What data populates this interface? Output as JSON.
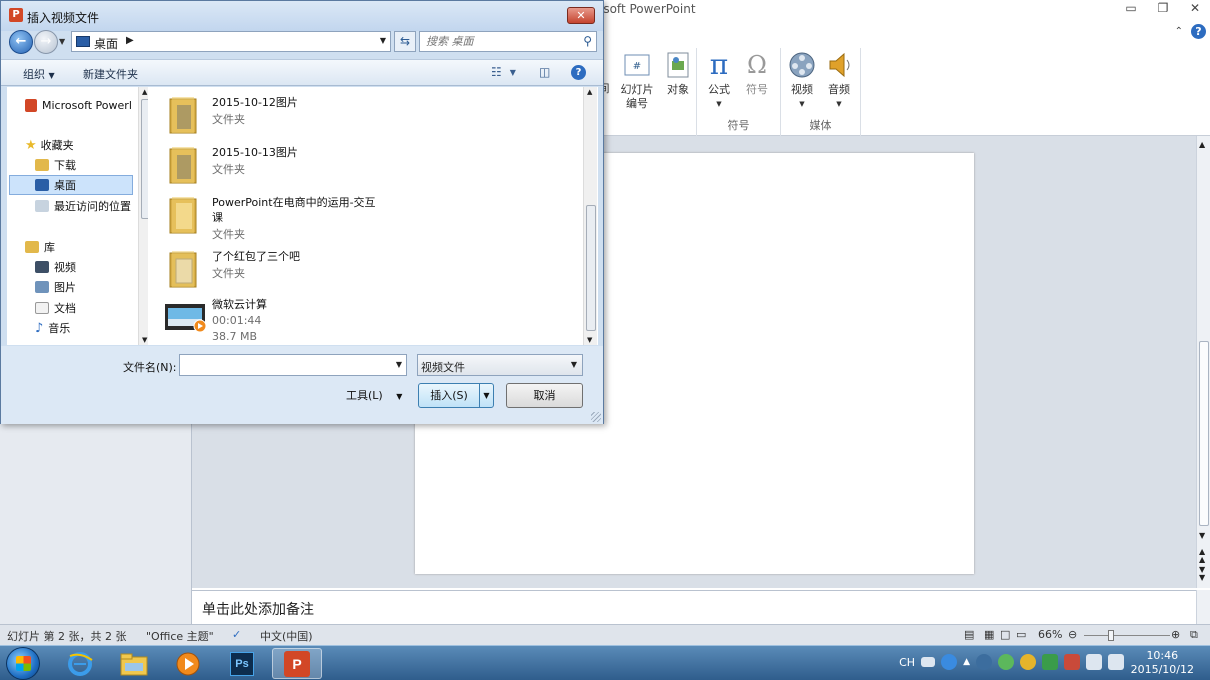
{
  "ppt": {
    "title_fragment": "osoft PowerPoint",
    "ribbon": {
      "items": [
        {
          "label": "间"
        },
        {
          "label": "幻灯片\n编号"
        },
        {
          "label": "对象"
        },
        {
          "label": "公式"
        },
        {
          "label": "符号"
        },
        {
          "label": "视频"
        },
        {
          "label": "音频"
        }
      ],
      "groups": [
        "符号",
        "媒体"
      ]
    },
    "notes_placeholder": "单击此处添加备注",
    "status": {
      "slide_info": "幻灯片 第 2 张，共 2 张",
      "theme": "\"Office 主题\"",
      "language": "中文(中国)",
      "zoom": "66%"
    }
  },
  "dialog": {
    "title": "插入视频文件",
    "app_icon_letter": "P",
    "address": {
      "location": "桌面"
    },
    "search": {
      "placeholder": "搜索 桌面"
    },
    "toolbar": {
      "organize": "组织",
      "new_folder": "新建文件夹"
    },
    "nav_pane": {
      "items": [
        {
          "label": "Microsoft Powerl",
          "icon": "powerpoint-icon"
        },
        {
          "label": "收藏夹",
          "icon": "star-icon"
        },
        {
          "label": "下载",
          "icon": "download-folder-icon"
        },
        {
          "label": "桌面",
          "icon": "desktop-icon",
          "selected": true
        },
        {
          "label": "最近访问的位置",
          "icon": "recent-places-icon"
        },
        {
          "label": "库",
          "icon": "library-icon"
        },
        {
          "label": "视频",
          "icon": "video-library-icon"
        },
        {
          "label": "图片",
          "icon": "pictures-library-icon"
        },
        {
          "label": "文档",
          "icon": "documents-library-icon"
        },
        {
          "label": "音乐",
          "icon": "music-library-icon"
        }
      ]
    },
    "files": [
      {
        "name": "2015-10-12图片",
        "type": "文件夹"
      },
      {
        "name": "2015-10-13图片",
        "type": "文件夹"
      },
      {
        "name": "PowerPoint在电商中的运用-交互课",
        "type": "文件夹"
      },
      {
        "name": "了个红包了三个吧",
        "type": "文件夹"
      },
      {
        "name": "微软云计算",
        "duration": "00:01:44",
        "size": "38.7 MB"
      }
    ],
    "filename_label": "文件名(N):",
    "filename_value": "",
    "filetype_value": "视频文件",
    "tools_label": "工具(L)",
    "insert_label": "插入(S)",
    "cancel_label": "取消"
  },
  "taskbar": {
    "lang": "CH",
    "time": "10:46",
    "date": "2015/10/12"
  }
}
